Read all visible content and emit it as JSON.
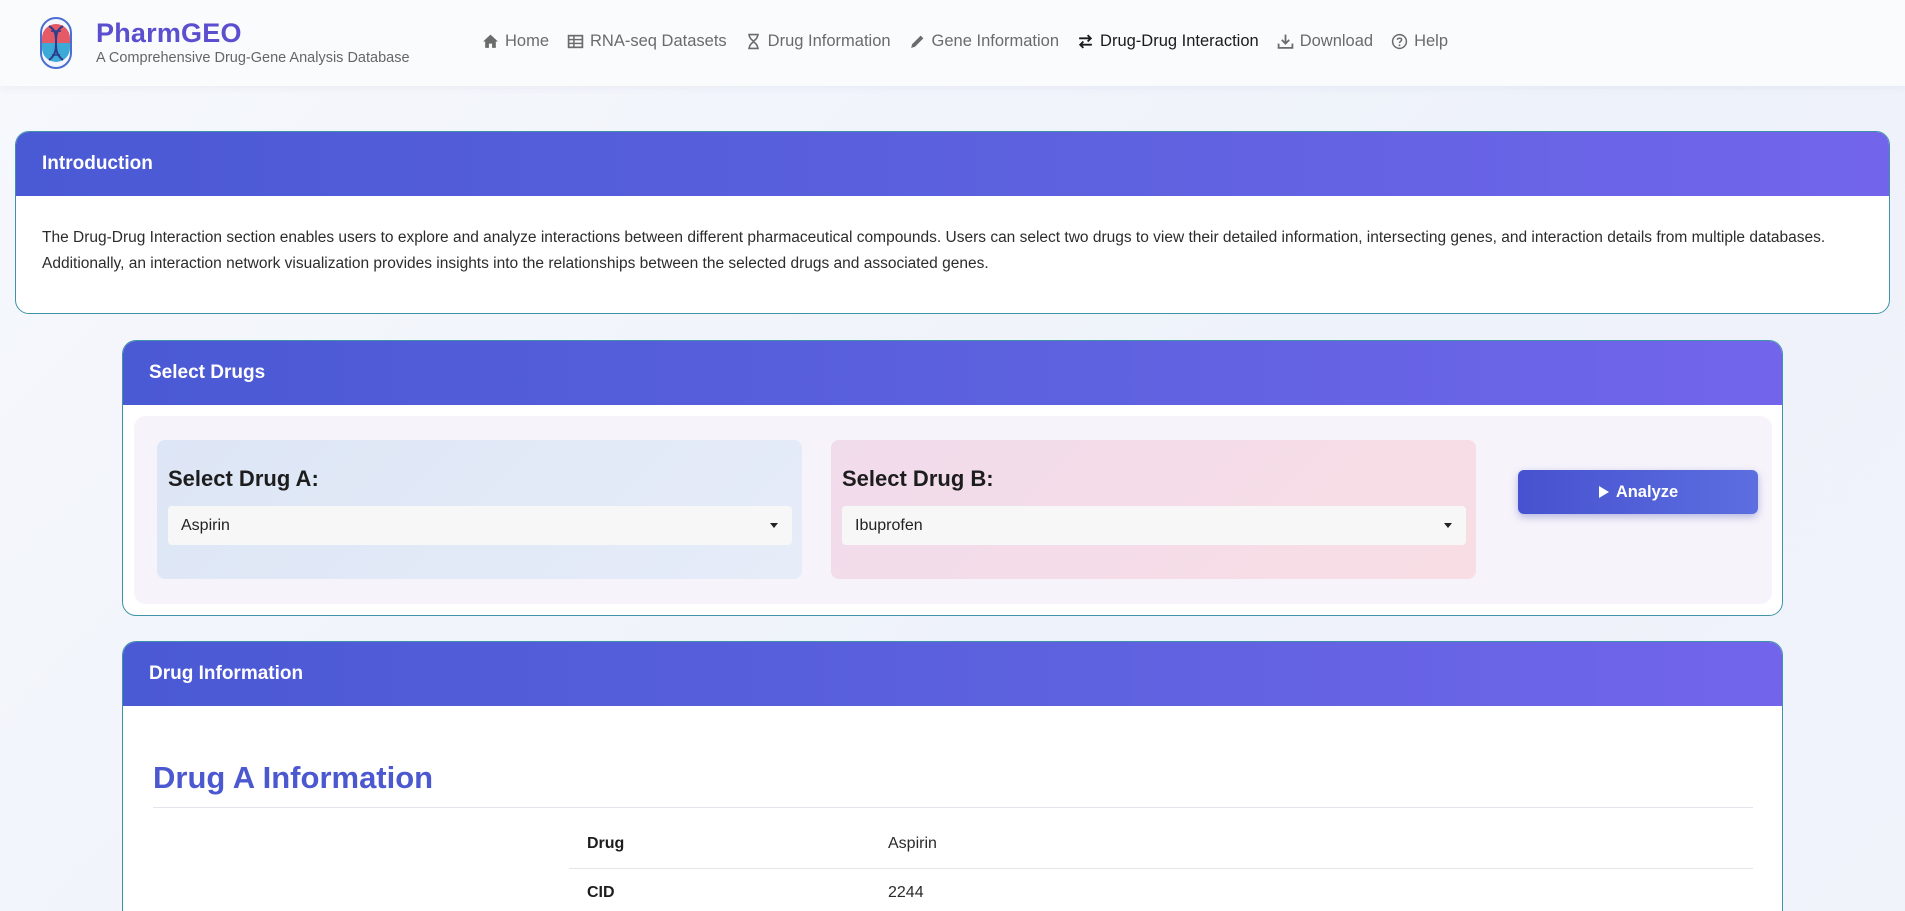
{
  "brand": {
    "title": "PharmGEO",
    "subtitle": "A Comprehensive Drug-Gene Analysis Database"
  },
  "nav": [
    {
      "label": "Home",
      "icon": "home-icon",
      "active": false
    },
    {
      "label": "RNA-seq Datasets",
      "icon": "table-icon",
      "active": false
    },
    {
      "label": "Drug Information",
      "icon": "hourglass-icon",
      "active": false
    },
    {
      "label": "Gene Information",
      "icon": "pencil-icon",
      "active": false
    },
    {
      "label": "Drug-Drug Interaction",
      "icon": "exchange-icon",
      "active": true
    },
    {
      "label": "Download",
      "icon": "download-icon",
      "active": false
    },
    {
      "label": "Help",
      "icon": "help-icon",
      "active": false
    }
  ],
  "intro": {
    "header": "Introduction",
    "text": "The Drug-Drug Interaction section enables users to explore and analyze interactions between different pharmaceutical compounds. Users can select two drugs to view their detailed information, intersecting genes, and interaction details from multiple databases. Additionally, an interaction network visualization provides insights into the relationships between the selected drugs and associated genes."
  },
  "select": {
    "header": "Select Drugs",
    "drug_a_label": "Select Drug A:",
    "drug_a_value": "Aspirin",
    "drug_b_label": "Select Drug B:",
    "drug_b_value": "Ibuprofen",
    "analyze_label": "Analyze"
  },
  "info": {
    "header": "Drug Information",
    "title": "Drug A Information",
    "rows": [
      {
        "key": "Drug",
        "value": "Aspirin"
      },
      {
        "key": "CID",
        "value": "2244"
      }
    ]
  },
  "colors": {
    "accent": "#5b4fd0",
    "header_gradient_start": "#4a59d4",
    "header_gradient_end": "#7265ec",
    "card_border": "#3f93a6"
  }
}
